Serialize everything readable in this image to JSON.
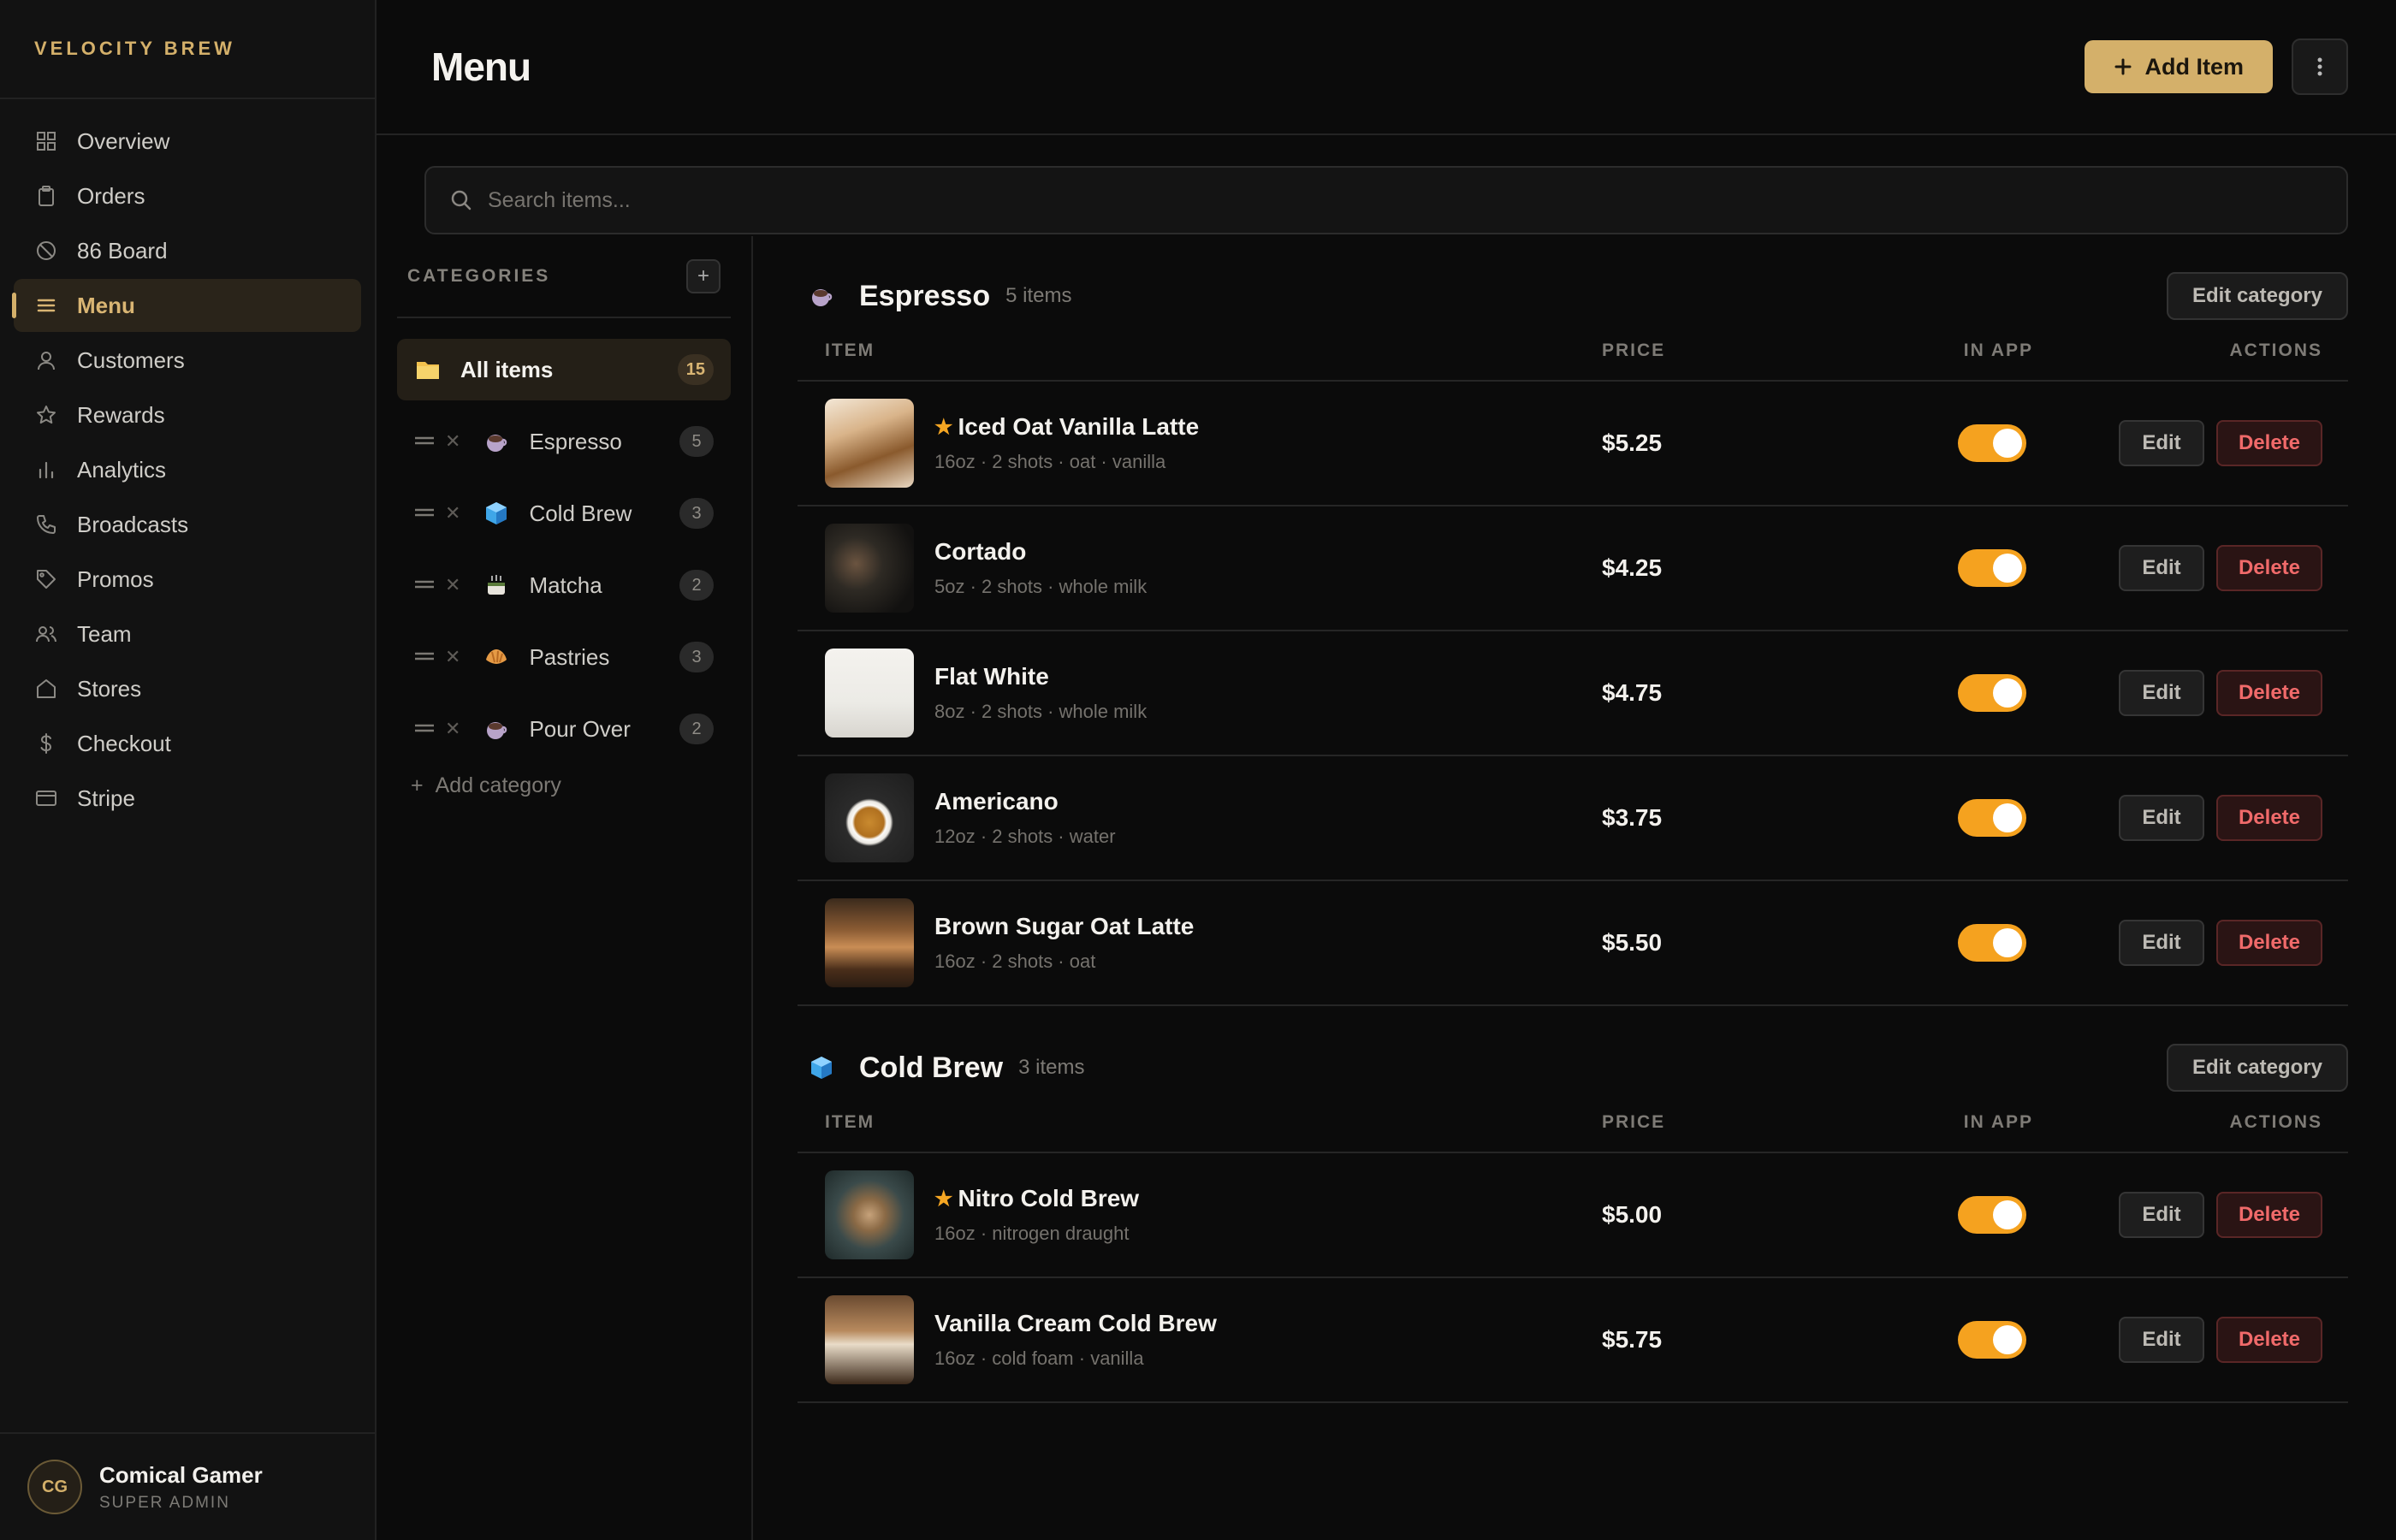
{
  "brand": "VELOCITY BREW",
  "nav": [
    {
      "label": "Overview",
      "icon": "grid-icon"
    },
    {
      "label": "Orders",
      "icon": "clipboard-icon"
    },
    {
      "label": "86 Board",
      "icon": "ban-icon"
    },
    {
      "label": "Menu",
      "icon": "menu-icon",
      "active": true
    },
    {
      "label": "Customers",
      "icon": "user-icon"
    },
    {
      "label": "Rewards",
      "icon": "star-icon"
    },
    {
      "label": "Analytics",
      "icon": "bar-chart-icon"
    },
    {
      "label": "Broadcasts",
      "icon": "phone-icon"
    },
    {
      "label": "Promos",
      "icon": "tag-icon"
    },
    {
      "label": "Team",
      "icon": "team-icon"
    },
    {
      "label": "Stores",
      "icon": "store-icon"
    },
    {
      "label": "Checkout",
      "icon": "dollar-icon"
    },
    {
      "label": "Stripe",
      "icon": "card-icon"
    }
  ],
  "user": {
    "initials": "CG",
    "name": "Comical Gamer",
    "role": "SUPER ADMIN"
  },
  "header": {
    "title": "Menu",
    "add_label": "Add Item"
  },
  "search": {
    "placeholder": "Search items..."
  },
  "categories": {
    "title": "CATEGORIES",
    "all": {
      "label": "All items",
      "count": "15"
    },
    "items": [
      {
        "name": "Espresso",
        "count": "5",
        "emoji": "☕"
      },
      {
        "name": "Cold Brew",
        "count": "3",
        "emoji": "🧊"
      },
      {
        "name": "Matcha",
        "count": "2",
        "emoji": "🍵"
      },
      {
        "name": "Pastries",
        "count": "3",
        "emoji": "🥐"
      },
      {
        "name": "Pour Over",
        "count": "2",
        "emoji": "☕"
      }
    ],
    "add_label": "Add category"
  },
  "columns": {
    "item": "ITEM",
    "price": "PRICE",
    "in_app": "IN APP",
    "actions": "ACTIONS"
  },
  "edit_category_label": "Edit category",
  "edit_label": "Edit",
  "delete_label": "Delete",
  "sections": [
    {
      "name": "Espresso",
      "count_label": "5 items",
      "emoji": "☕",
      "items": [
        {
          "name": "Iced Oat Vanilla Latte",
          "desc": "16oz · 2 shots · oat · vanilla",
          "price": "$5.25",
          "featured": true,
          "in_app": true
        },
        {
          "name": "Cortado",
          "desc": "5oz · 2 shots · whole milk",
          "price": "$4.25",
          "featured": false,
          "in_app": true
        },
        {
          "name": "Flat White",
          "desc": "8oz · 2 shots · whole milk",
          "price": "$4.75",
          "featured": false,
          "in_app": true
        },
        {
          "name": "Americano",
          "desc": "12oz · 2 shots · water",
          "price": "$3.75",
          "featured": false,
          "in_app": true
        },
        {
          "name": "Brown Sugar Oat Latte",
          "desc": "16oz · 2 shots · oat",
          "price": "$5.50",
          "featured": false,
          "in_app": true
        }
      ]
    },
    {
      "name": "Cold Brew",
      "count_label": "3 items",
      "emoji": "🧊",
      "items": [
        {
          "name": "Nitro Cold Brew",
          "desc": "16oz · nitrogen draught",
          "price": "$5.00",
          "featured": true,
          "in_app": true
        },
        {
          "name": "Vanilla Cream Cold Brew",
          "desc": "16oz · cold foam · vanilla",
          "price": "$5.75",
          "featured": false,
          "in_app": true
        }
      ]
    }
  ],
  "colors": {
    "accent": "#d4b06a",
    "toggle_on": "#f5a21f",
    "danger": "#f06a6a",
    "background": "#0b0b0b"
  }
}
